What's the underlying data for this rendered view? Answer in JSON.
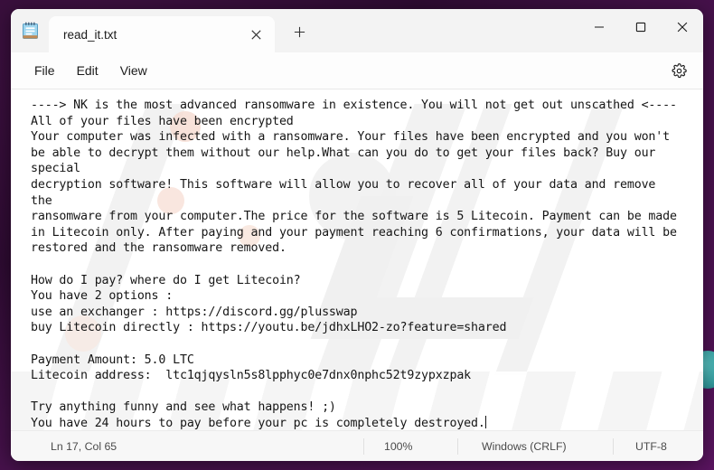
{
  "window": {
    "app_icon": "notepad-icon",
    "controls": {
      "minimize": "minimize-icon",
      "maximize": "maximize-icon",
      "close": "close-icon"
    }
  },
  "tabs": {
    "active_tab_title": "read_it.txt",
    "close_tab_icon": "close-icon",
    "new_tab_icon": "plus-icon"
  },
  "menubar": {
    "items": [
      {
        "label": "File"
      },
      {
        "label": "Edit"
      },
      {
        "label": "View"
      }
    ],
    "settings_icon": "gear-icon"
  },
  "document": {
    "lines": [
      "----> NK is the most advanced ransomware in existence. You will not get out unscathed <----",
      "All of your files have been encrypted",
      "Your computer was infected with a ransomware. Your files have been encrypted and you won't",
      "be able to decrypt them without our help.What can you do to get your files back? Buy our",
      "special",
      "decryption software! This software will allow you to recover all of your data and remove",
      "the",
      "ransomware from your computer.The price for the software is 5 Litecoin. Payment can be made",
      "in Litecoin only. After paying and your payment reaching 6 confirmations, your data will be",
      "restored and the ransomware removed.",
      "",
      "How do I pay? where do I get Litecoin?",
      "You have 2 options :",
      "use an exchanger : https://discord.gg/plusswap",
      "buy Litecoin directly : https://youtu.be/jdhxLHO2-zo?feature=shared",
      "",
      "Payment Amount: 5.0 LTC",
      "Litecoin address:  ltc1qjqysln5s8lpphyc0e7dnx0nphc52t9zypxzpak",
      "",
      "Try anything funny and see what happens! ;)",
      "You have 24 hours to pay before your pc is completely destroyed."
    ]
  },
  "statusbar": {
    "position": "Ln 17, Col 65",
    "zoom": "100%",
    "line_endings": "Windows (CRLF)",
    "encoding": "UTF-8"
  },
  "colors": {
    "desktop": "#3d1040",
    "window": "#fdfdfd",
    "titlebar": "#f3f3f3",
    "text": "#161616",
    "status_text": "#4a4a4a",
    "close_hover": "#c42b1c"
  }
}
